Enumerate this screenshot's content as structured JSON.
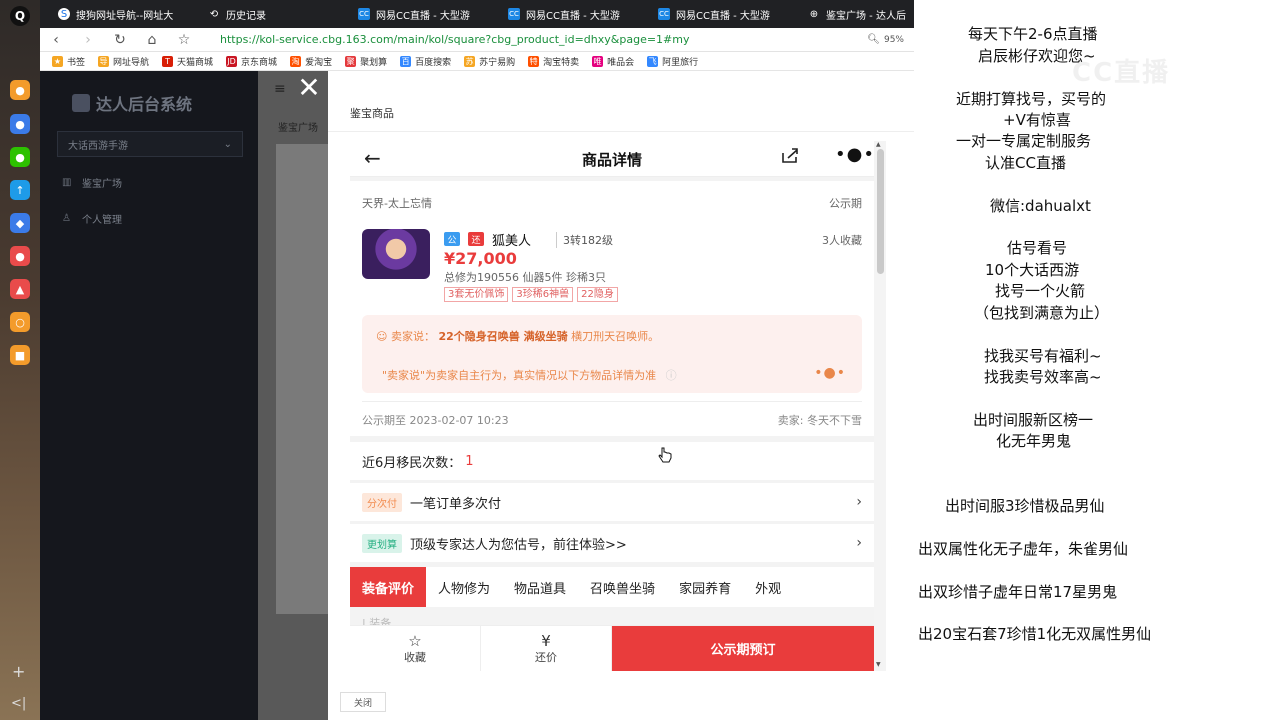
{
  "browser": {
    "tabs": [
      {
        "title": "搜狗网址导航--网址大",
        "icon": "globe-icon"
      },
      {
        "title": "历史记录",
        "icon": "history-icon"
      },
      {
        "title": "网易CC直播 - 大型游",
        "icon": "cc-icon"
      },
      {
        "title": "网易CC直播 - 大型游",
        "icon": "cc-icon"
      },
      {
        "title": "网易CC直播 - 大型游",
        "icon": "cc-icon"
      },
      {
        "title": "鉴宝广场 - 达人后",
        "icon": "globe-icon"
      }
    ],
    "url": "https://kol-service.cbg.163.com/main/kol/square?cbg_product_id=dhxy&page=1#my",
    "zoom": "95%",
    "bookmarks": [
      {
        "label": "书签",
        "color": "#f5a623"
      },
      {
        "label": "网址导航",
        "color": "#f5a623"
      },
      {
        "label": "天猫商城",
        "color": "#d81e06"
      },
      {
        "label": "京东商城",
        "color": "#c91623"
      },
      {
        "label": "爱淘宝",
        "color": "#ff5000"
      },
      {
        "label": "聚划算",
        "color": "#e4393c"
      },
      {
        "label": "百度搜索",
        "color": "#3388ff"
      },
      {
        "label": "苏宁易购",
        "color": "#f5a623"
      },
      {
        "label": "淘宝特卖",
        "color": "#ff5000"
      },
      {
        "label": "唯品会",
        "color": "#e5007f"
      },
      {
        "label": "阿里旅行",
        "color": "#3388ff"
      }
    ],
    "bookmark_badges": [
      "★",
      "导",
      "T",
      "JD",
      "淘",
      "聚",
      "百",
      "苏",
      "特",
      "唯",
      "飞"
    ]
  },
  "admin": {
    "logo": "达人后台系统",
    "game_select": "大话西游手游",
    "nav": [
      "鉴宝广场",
      "个人管理"
    ],
    "breadcrumb": "鉴宝广场"
  },
  "drawer": {
    "title": "鉴宝商品",
    "close_label": "关闭"
  },
  "product": {
    "header_title": "商品详情",
    "server": "天界-太上忘情",
    "status": "公示期",
    "badge_gong": "公",
    "badge_huan": "还",
    "role": "狐美人",
    "level": "3转182级",
    "favorites": "3人收藏",
    "price": "¥27,000",
    "stats": "总修为190556  仙器5件  珍稀3只",
    "tags": [
      "3套无价佩饰",
      "3珍稀6神兽",
      "22隐身"
    ],
    "seller_says_label": "卖家说：",
    "seller_says_bold": "22个隐身召唤兽 满级坐骑",
    "seller_says_rest": "横刀刑天召唤师。",
    "disclaimer": "\"卖家说\"为卖家自主行为，真实情况以下方物品详情为准",
    "public_until": "公示期至 2023-02-07 10:23",
    "seller_name": "卖家: 冬天不下雪",
    "migrate_label": "近6月移民次数：",
    "migrate_count": "1",
    "install_pill": "分次付",
    "install_text": "一笔订单多次付",
    "eval_pill": "更划算",
    "eval_text": "顶级专家达人为您估号，前往体验>>",
    "tabs": [
      "装备评价",
      "人物修为",
      "物品道具",
      "召唤兽坐骑",
      "家园养育",
      "外观"
    ],
    "section_peek": "| 装备",
    "fav_label": "收藏",
    "bargain_label": "还价",
    "reserve_label": "公示期预订"
  },
  "overlay": {
    "lines": [
      "每天下午2-6点直播",
      "启辰彬仔欢迎您~",
      "近期打算找号，买号的",
      "+V有惊喜",
      "一对一专属定制服务",
      "认准CC直播",
      "微信:dahualxt",
      "估号看号",
      "10个大话西游",
      "找号一个火箭",
      "（包找到满意为止）",
      "找我买号有福利~",
      "找我卖号效率高~",
      "出时间服新区榜一",
      "化无年男鬼",
      "出时间服3珍惜极品男仙",
      "出双属性化无子虚年，朱雀男仙",
      "出双珍惜子虚年日常17星男鬼",
      "出20宝石套7珍惜1化无双属性男仙"
    ],
    "watermark": "CC直播"
  },
  "colors": {
    "accent_red": "#e93c3c",
    "url_green": "#1a8f3c",
    "seller_orange": "#e9874a"
  }
}
